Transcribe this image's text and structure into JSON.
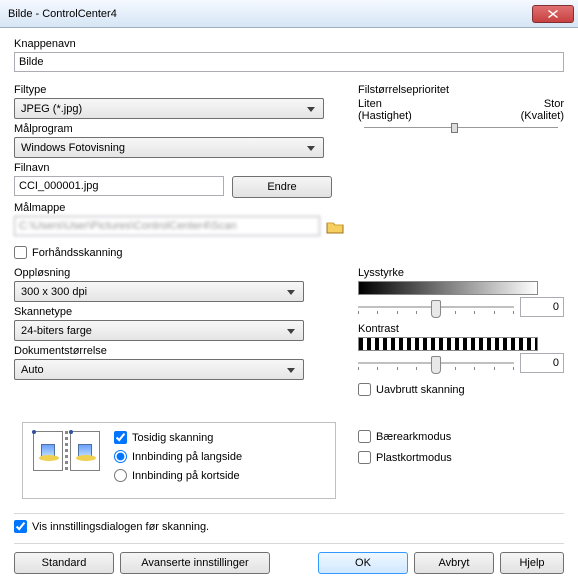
{
  "title": "Bilde - ControlCenter4",
  "labels": {
    "knappenavn": "Knappenavn",
    "filtype": "Filtype",
    "malprogram": "Målprogram",
    "filnavn": "Filnavn",
    "malmappe": "Målmappe",
    "forhandsskanning": "Forhåndsskanning",
    "opplosning": "Oppløsning",
    "skannetype": "Skannetype",
    "dokstr": "Dokumentstørrelse",
    "filstrpri": "Filstørrelseprioritet",
    "liten": "Liten",
    "stor": "Stor",
    "hastighet": "(Hastighet)",
    "kvalitet": "(Kvalitet)",
    "lysstyrke": "Lysstyrke",
    "kontrast": "Kontrast",
    "uavbrutt": "Uavbrutt skanning",
    "baereark": "Bærearkmodus",
    "plastkort": "Plastkortmodus",
    "tosidig": "Tosidig skanning",
    "langside": "Innbinding på langside",
    "kortside": "Innbinding på kortside",
    "visinnst": "Vis innstillingsdialogen før skanning.",
    "endre": "Endre"
  },
  "values": {
    "knappenavn": "Bilde",
    "filtype": "JPEG (*.jpg)",
    "malprogram": "Windows Fotovisning",
    "filnavn": "CCI_000001.jpg",
    "malmappe": "C:\\Users\\User\\Pictures\\ControlCenter4\\Scan",
    "opplosning": "300 x 300 dpi",
    "skannetype": "24-biters farge",
    "dokstr": "Auto",
    "lysstyrke": "0",
    "kontrast": "0"
  },
  "buttons": {
    "standard": "Standard",
    "avanserte": "Avanserte innstillinger",
    "ok": "OK",
    "avbryt": "Avbryt",
    "hjelp": "Hjelp"
  }
}
